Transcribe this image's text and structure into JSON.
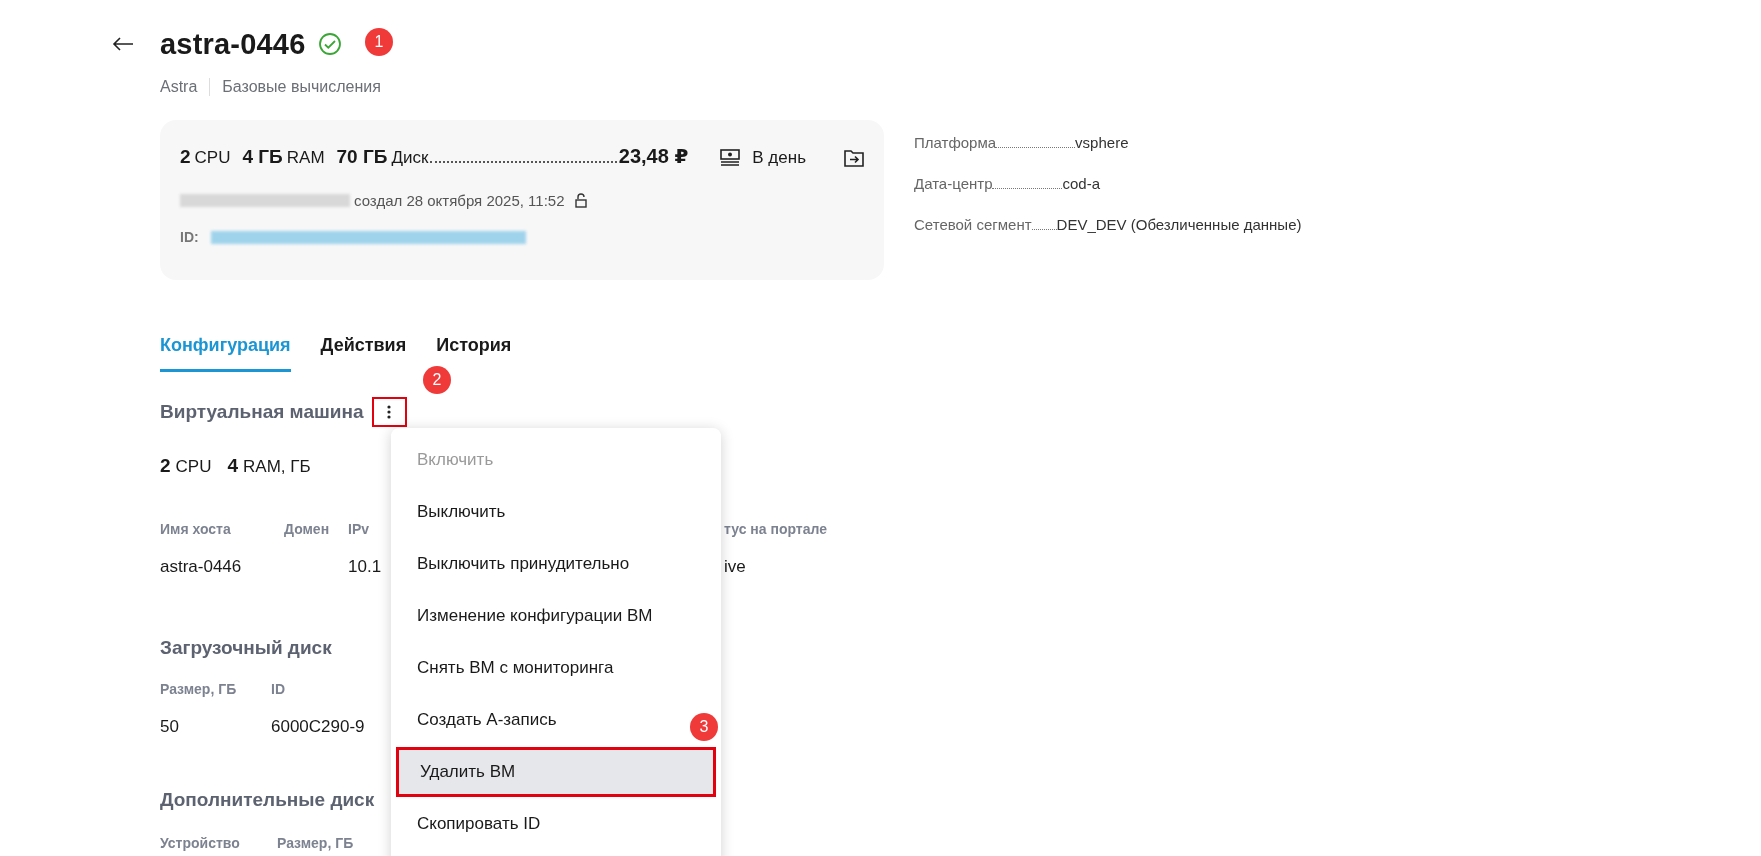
{
  "header": {
    "title": "astra-0446",
    "status_ok": true,
    "breadcrumbs": [
      "Astra",
      "Базовые вычисления"
    ]
  },
  "summary": {
    "specs": [
      {
        "value": "2",
        "unit": "CPU"
      },
      {
        "value": "4 ГБ",
        "unit": "RAM"
      },
      {
        "value": "70 ГБ",
        "unit": "Диск"
      }
    ],
    "price": "23,48 ₽",
    "period": "В день",
    "created": "создал 28 октября 2025, 11:52",
    "id_label": "ID:"
  },
  "info": [
    {
      "label": "Платформа",
      "value": "vsphere"
    },
    {
      "label": "Дата-центр",
      "value": "cod-a"
    },
    {
      "label": "Сетевой сегмент",
      "value": "DEV_DEV (Обезличенные данные)"
    }
  ],
  "tabs": [
    {
      "label": "Конфигурация",
      "selected": true
    },
    {
      "label": "Действия",
      "selected": false
    },
    {
      "label": "История",
      "selected": false
    }
  ],
  "vm": {
    "title": "Виртуальная машина",
    "resources": [
      {
        "value": "2",
        "unit": "CPU"
      },
      {
        "value": "4",
        "unit": "RAM, ГБ"
      }
    ],
    "columns": [
      {
        "label": "Имя хоста",
        "value": "astra-0446"
      },
      {
        "label": "Домен"
      },
      {
        "label": "IPv",
        "value": "10.1"
      },
      {
        "label": "тус на портале",
        "value": "ive"
      }
    ]
  },
  "boot_disk": {
    "title": "Загрузочный диск",
    "columns": [
      "Размер, ГБ",
      "ID"
    ],
    "row": [
      "50",
      "6000C290-9"
    ]
  },
  "extra_disks": {
    "title": "Дополнительные диск",
    "columns": [
      "Устройство",
      "Размер, ГБ"
    ]
  },
  "menu": [
    {
      "label": "Включить",
      "disabled": true,
      "selected": false
    },
    {
      "label": "Выключить",
      "disabled": false,
      "selected": false
    },
    {
      "label": "Выключить принудительно",
      "disabled": false,
      "selected": false
    },
    {
      "label": "Изменение конфигурации ВМ",
      "disabled": false,
      "selected": false
    },
    {
      "label": "Снять ВМ с мониторинга",
      "disabled": false,
      "selected": false
    },
    {
      "label": "Создать А-запись",
      "disabled": false,
      "selected": false
    },
    {
      "label": "Удалить ВМ",
      "disabled": false,
      "selected": true
    },
    {
      "label": "Скопировать ID",
      "disabled": false,
      "selected": false
    }
  ],
  "callouts": [
    "1",
    "2",
    "3"
  ]
}
